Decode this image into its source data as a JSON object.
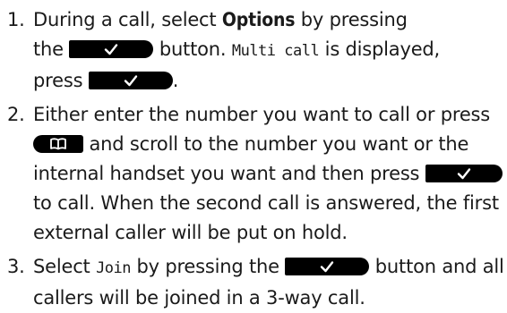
{
  "steps": [
    {
      "num": "1.",
      "line1_a": "During a call, select ",
      "line1_bold": "Options",
      "line1_b": " by pressing",
      "line2_a": "the ",
      "line2_b": " button. ",
      "line2_lcd": "Multi call",
      "line2_c": " is displayed,",
      "line3_a": "press ",
      "line3_b": "."
    },
    {
      "num": "2.",
      "line1": "Either enter the number you want to call or press",
      "line2": " and scroll to the number you want or the",
      "line3": "internal handset you want and then press ",
      "line4": "to call. When the second call is answered, the first",
      "line5": "external caller will be put on hold."
    },
    {
      "num": "3.",
      "line1_a": "Select ",
      "line1_lcd": "Join",
      "line1_b": " by pressing the ",
      "line1_c": " button and all",
      "line2": "callers will be joined in a 3-way call."
    }
  ],
  "icons": {
    "ok_key": "checkmark-softkey-icon",
    "phonebook_key": "phonebook-key-icon"
  },
  "colors": {
    "text": "#1a1a1a",
    "key_bg": "#000000",
    "key_fg": "#ffffff"
  }
}
